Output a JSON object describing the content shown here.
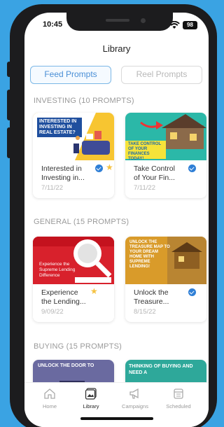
{
  "status": {
    "time": "10:45",
    "battery": "98"
  },
  "header": {
    "title": "Library"
  },
  "tabs": {
    "feed": "Feed Prompts",
    "reel": "Reel Prompts"
  },
  "sections": [
    {
      "heading": "INVESTING (10 PROMPTS)",
      "cards": [
        {
          "thumb_text": "INTERESTED IN INVESTING IN REAL ESTATE?",
          "title": "Interested in Investing in...",
          "date": "7/11/22",
          "verified": true,
          "starred": true
        },
        {
          "thumb_text": "TAKE CONTROL OF YOUR FINANCES TODAY!",
          "title": "Take Control of Your Fin...",
          "date": "7/11/22",
          "verified": true,
          "starred": false
        }
      ]
    },
    {
      "heading": "GENERAL  (15 PROMPTS)",
      "cards": [
        {
          "thumb_text": "Experience the Supreme Lending Difference",
          "title": "Experience the Lending...",
          "date": "9/09/22",
          "verified": false,
          "starred": true
        },
        {
          "thumb_text": "UNLOCK THE TREASURE MAP TO YOUR DREAM HOME WITH SUPREME LENDING!",
          "title": "Unlock the Treasure...",
          "date": "8/15/22",
          "verified": true,
          "starred": false
        }
      ]
    },
    {
      "heading": "BUYING  (15 PROMPTS)",
      "cards": [
        {
          "thumb_text": "UNLOCK THE DOOR TO",
          "title": "",
          "date": "",
          "verified": false,
          "starred": false
        },
        {
          "thumb_text": "THINKING OF BUYING AND NEED A",
          "title": "",
          "date": "",
          "verified": false,
          "starred": false
        }
      ]
    }
  ],
  "tabbar": [
    {
      "label": "Home",
      "icon": "home-icon"
    },
    {
      "label": "Library",
      "icon": "library-icon"
    },
    {
      "label": "Campaigns",
      "icon": "megaphone-icon"
    },
    {
      "label": "Scheduled",
      "icon": "calendar-icon"
    }
  ],
  "colors": {
    "accent": "#4a8fd6",
    "background": "#3aa3e3",
    "verified": "#2f7fd6",
    "star": "#f5c242"
  }
}
